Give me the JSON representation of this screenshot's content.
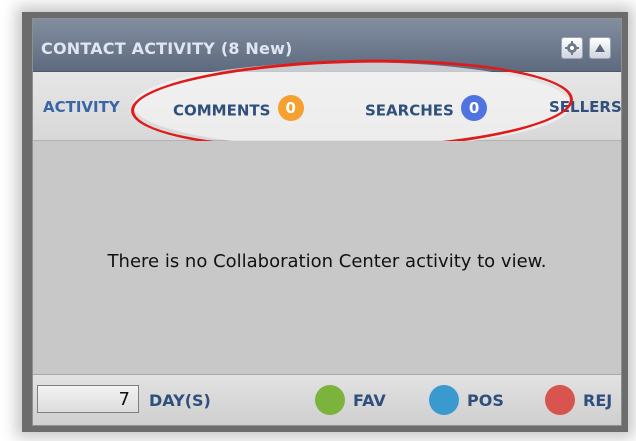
{
  "panel": {
    "title": "CONTACT ACTIVITY (8 New)"
  },
  "header_icons": {
    "settings": "gear-icon",
    "collapse": "triangle-up-icon"
  },
  "tabs": [
    {
      "label": "ACTIVITY",
      "badge": null
    },
    {
      "label": "COMMENTS",
      "badge": "0",
      "badge_color": "#f5a030"
    },
    {
      "label": "SEARCHES",
      "badge": "0",
      "badge_color": "#4f73e0"
    },
    {
      "label": "SELLERS",
      "badge": null
    }
  ],
  "body": {
    "empty_message": "There is no Collaboration Center activity to view."
  },
  "footer": {
    "days_value": "7",
    "days_label": "DAY(S)",
    "legend": [
      {
        "label": "FAV",
        "color": "#7bb33c"
      },
      {
        "label": "POS",
        "color": "#3a9ad0"
      },
      {
        "label": "REJ",
        "color": "#d9534f"
      }
    ]
  },
  "annotation_color": "#e01919"
}
